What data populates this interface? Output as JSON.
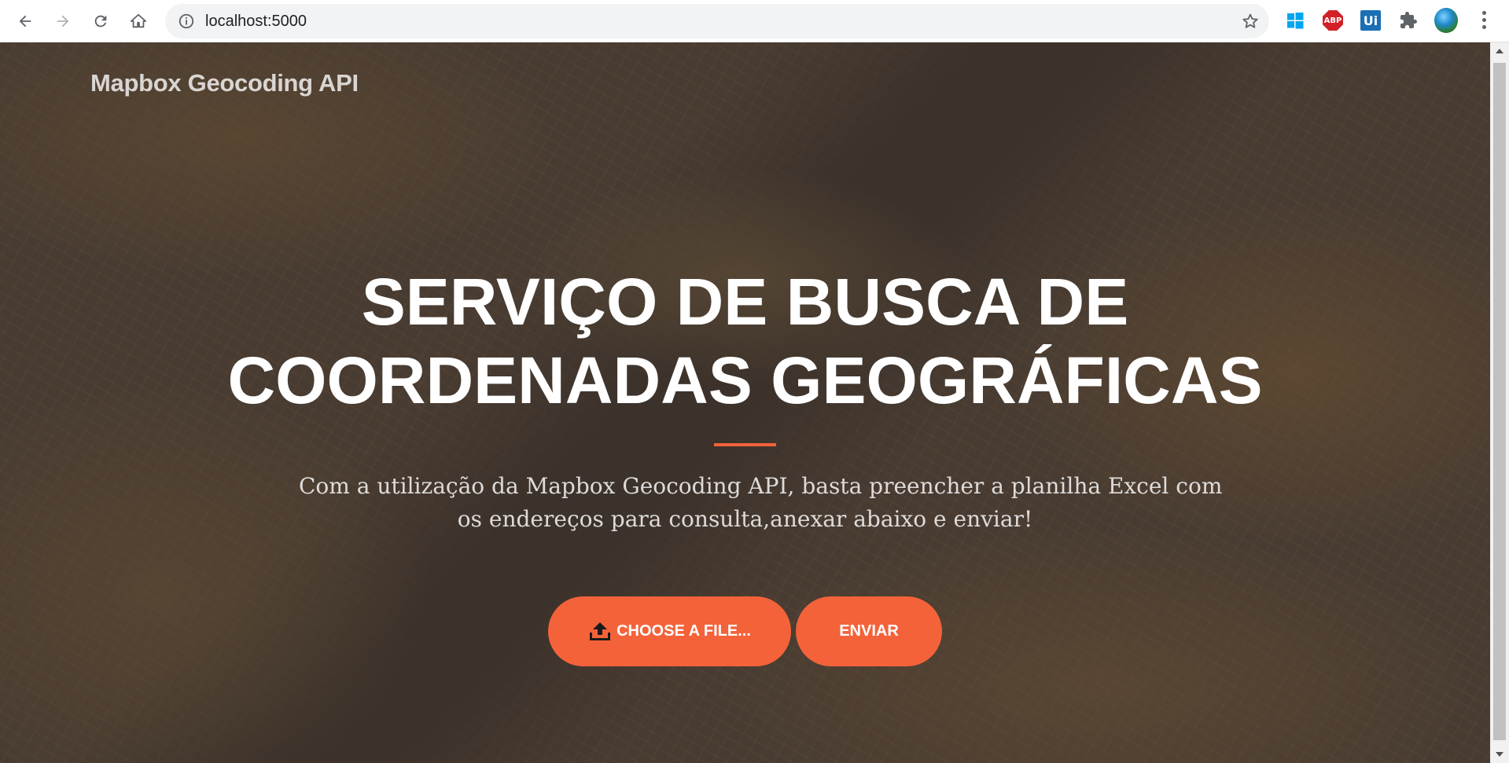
{
  "browser": {
    "url": "localhost:5000",
    "icons": {
      "back": "arrow-left-icon",
      "forward": "arrow-right-icon",
      "reload": "reload-icon",
      "home": "home-icon",
      "site_info": "info-icon",
      "bookmark": "star-icon",
      "extensions": "puzzle-icon",
      "menu": "more-vert-icon"
    },
    "extensions": {
      "abp_label": "ABP",
      "ui_label": "Ui"
    }
  },
  "page": {
    "brand": "Mapbox Geocoding API",
    "hero_title_lines": [
      "SERVIÇO DE BUSCA DE",
      "COORDENADAS GEOGRÁFICAS"
    ],
    "subtitle_lines": [
      "Com a utilização da Mapbox Geocoding API, basta preencher a planilha Excel com",
      "os endereços para consulta,anexar abaixo e enviar!"
    ],
    "choose_file_label": "Choose a file...",
    "send_label": "ENVIAR",
    "accent_color": "#f4623a"
  }
}
